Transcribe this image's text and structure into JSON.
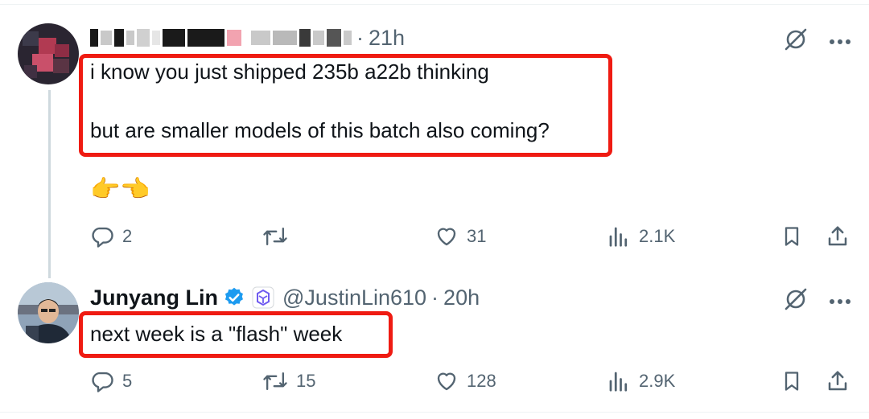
{
  "tweets": [
    {
      "time": "21h",
      "text_line1": "i know you just shipped 235b a22b thinking",
      "text_line2": "but are smaller models of this batch also coming?",
      "emoji": "👉👈",
      "metrics": {
        "replies": "2",
        "likes": "31",
        "views": "2.1K"
      }
    },
    {
      "name": "Junyang Lin",
      "handle": "@JustinLin610",
      "separator": "·",
      "time": "20h",
      "text": "next week is a \"flash\" week",
      "metrics": {
        "replies": "5",
        "reposts": "15",
        "likes": "128",
        "views": "2.9K"
      }
    }
  ],
  "icons": {
    "reply": "reply-icon",
    "repost": "repost-icon",
    "like": "heart-icon",
    "views": "views-icon",
    "bookmark": "bookmark-icon",
    "share": "share-icon",
    "grok": "grok-icon",
    "more": "more-icon",
    "verified": "verified-badge-icon",
    "affiliate": "affiliate-badge-icon"
  },
  "colors": {
    "highlight": "#ef1b12",
    "verified": "#1d9bf0",
    "muted": "#536471"
  }
}
